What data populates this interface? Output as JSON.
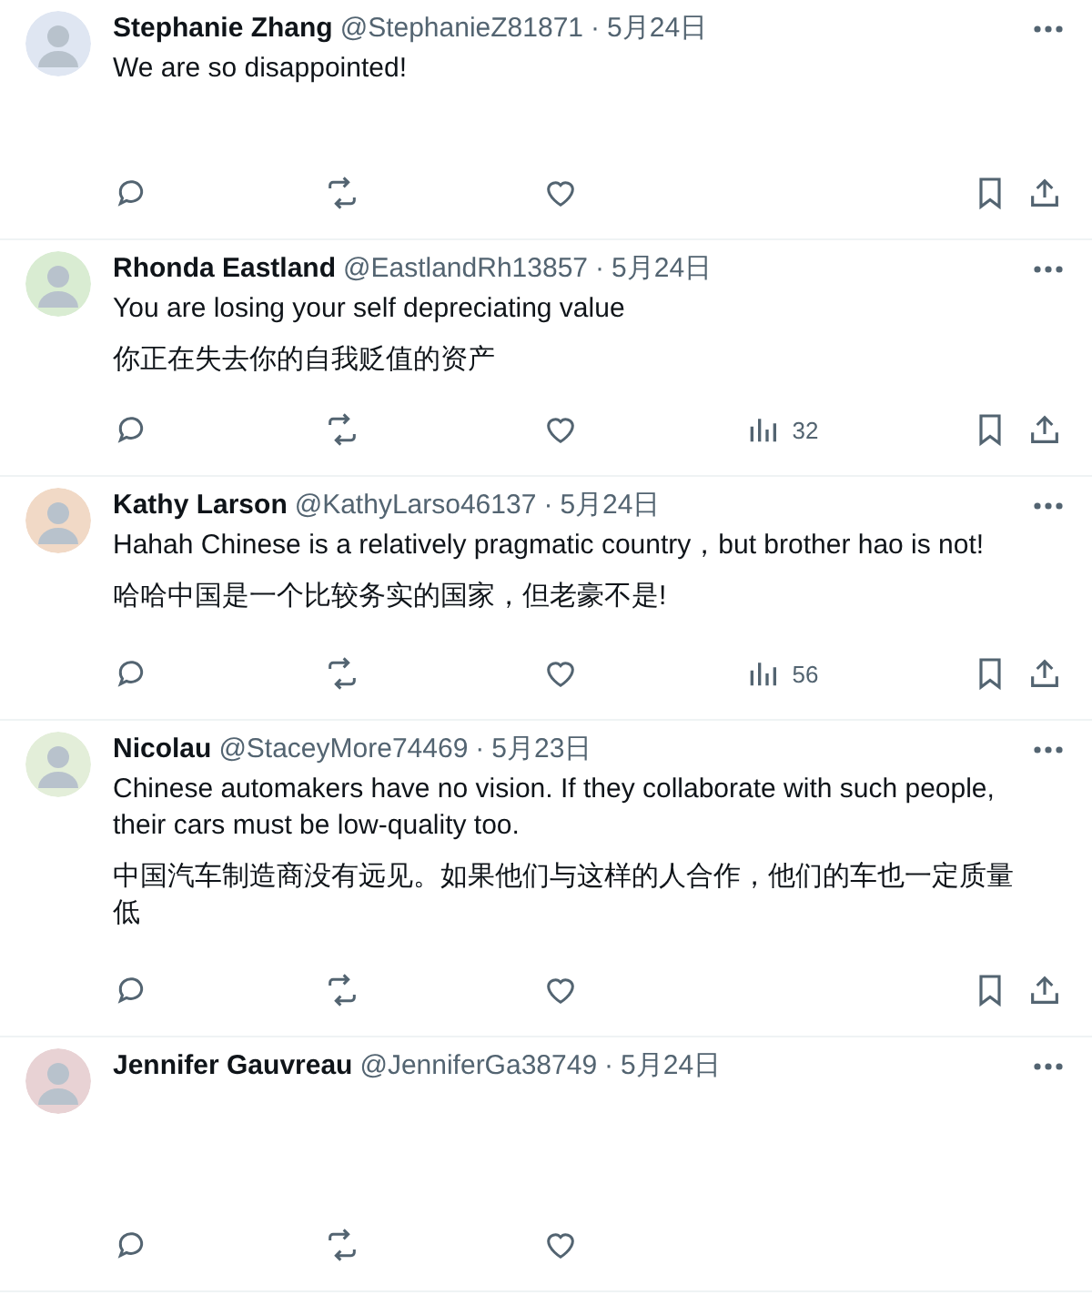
{
  "replies": [
    {
      "name": "Stephanie Zhang",
      "handle": "@StephanieZ81871",
      "separator": "·",
      "date": "5月24日",
      "lines": [
        "We are so disappointed!"
      ],
      "end_actions_visible": true
    },
    {
      "name": "Rhonda Eastland",
      "handle": "@EastlandRh13857",
      "separator": "·",
      "date": "5月24日",
      "lines": [
        "You are losing your self depreciating value",
        "你正在失去你的自我贬值的资产"
      ],
      "views": "32",
      "end_actions_visible": true
    },
    {
      "name": "Kathy Larson",
      "handle": "@KathyLarso46137",
      "separator": "·",
      "date": "5月24日",
      "lines": [
        "Hahah Chinese is a relatively pragmatic country，but brother hao is not!",
        "哈哈中国是一个比较务实的国家，但老豪不是!"
      ],
      "views": "56",
      "end_actions_visible": true
    },
    {
      "name": "Nicolau",
      "handle": "@StaceyMore74469",
      "separator": "·",
      "date": "5月23日",
      "lines": [
        "Chinese automakers have no vision. If they collaborate with such people, their cars must be low-quality too.",
        "中国汽车制造商没有远见。如果他们与这样的人合作，他们的车也一定质量低"
      ],
      "end_actions_visible": true
    },
    {
      "name": "Jennifer Gauvreau",
      "handle": "@JenniferGa38749",
      "separator": "·",
      "date": "5月24日",
      "end_actions_visible": false
    }
  ]
}
